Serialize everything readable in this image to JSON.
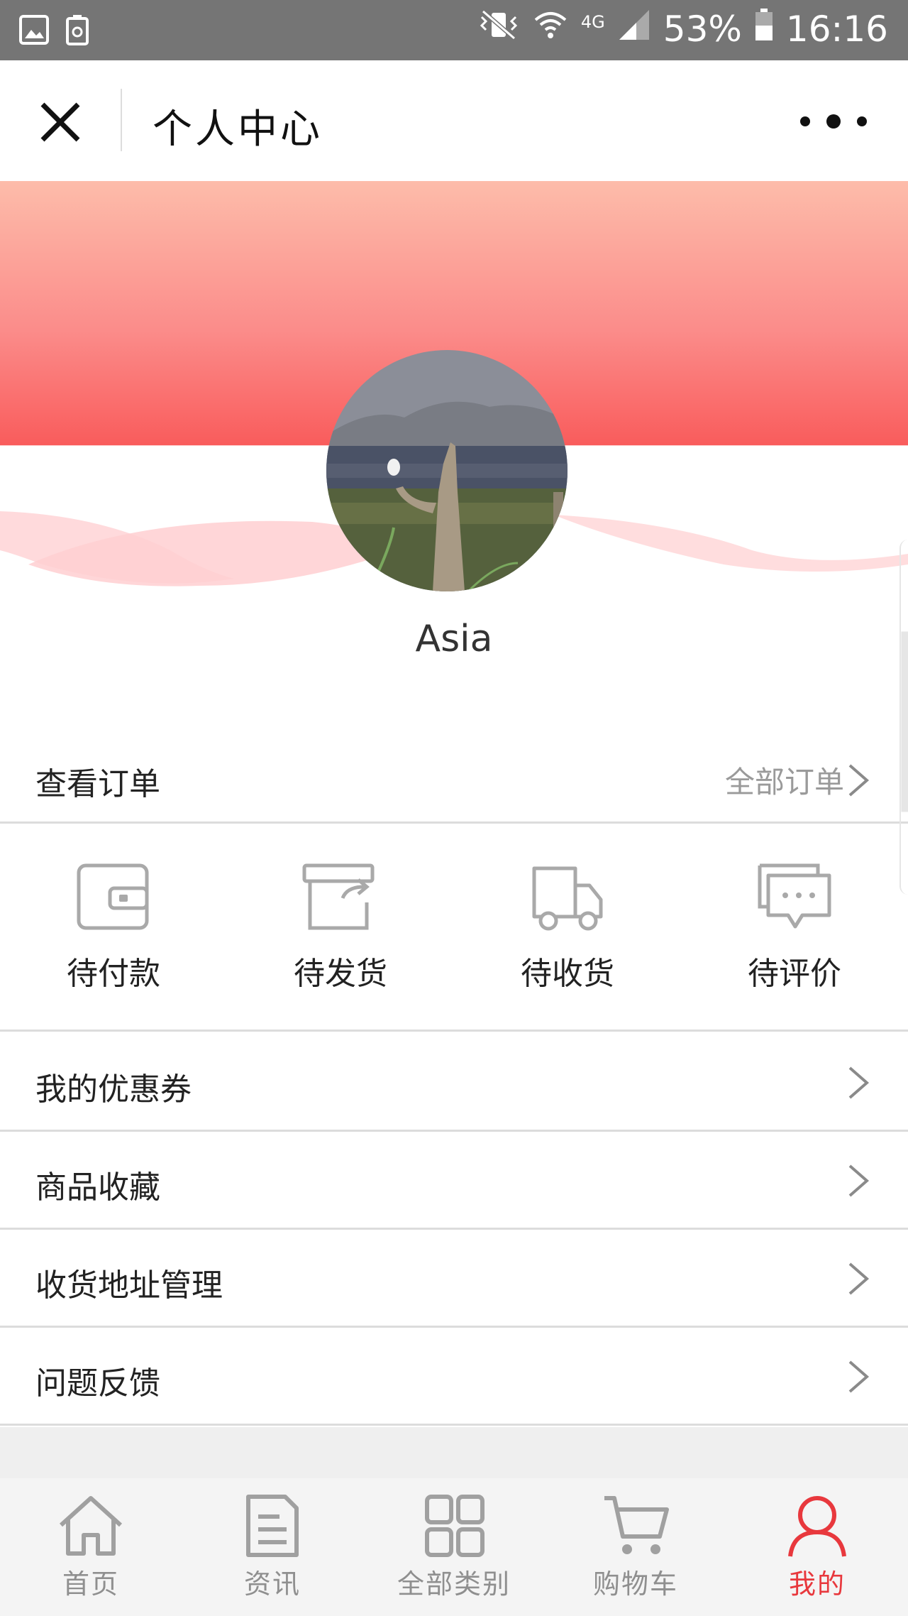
{
  "status_bar": {
    "battery": "53%",
    "time": "16:16",
    "network": "4G"
  },
  "header": {
    "title": "个人中心",
    "close_icon": "close-icon",
    "more_icon": "more-dots-icon"
  },
  "profile": {
    "username": "Asia",
    "avatar": "avatar-photo"
  },
  "orders": {
    "title": "查看订单",
    "all_link": "全部订单",
    "statuses": [
      {
        "label": "待付款",
        "icon": "wallet-icon"
      },
      {
        "label": "待发货",
        "icon": "box-outgoing-icon"
      },
      {
        "label": "待收货",
        "icon": "truck-icon"
      },
      {
        "label": "待评价",
        "icon": "chat-review-icon"
      }
    ]
  },
  "menu": [
    {
      "label": "我的优惠券"
    },
    {
      "label": "商品收藏"
    },
    {
      "label": "收货地址管理"
    },
    {
      "label": "问题反馈"
    }
  ],
  "tabbar": {
    "active_color": "#e8383d",
    "inactive_color": "#8f8f8f",
    "items": [
      {
        "label": "首页",
        "icon": "home-icon"
      },
      {
        "label": "资讯",
        "icon": "document-icon"
      },
      {
        "label": "全部类别",
        "icon": "grid-icon"
      },
      {
        "label": "购物车",
        "icon": "cart-icon"
      },
      {
        "label": "我的",
        "icon": "user-icon",
        "active": true
      }
    ]
  },
  "colors": {
    "hero_top": "#fdbcaa",
    "hero_bottom": "#f95c5c",
    "divider": "#dcdcdc"
  }
}
